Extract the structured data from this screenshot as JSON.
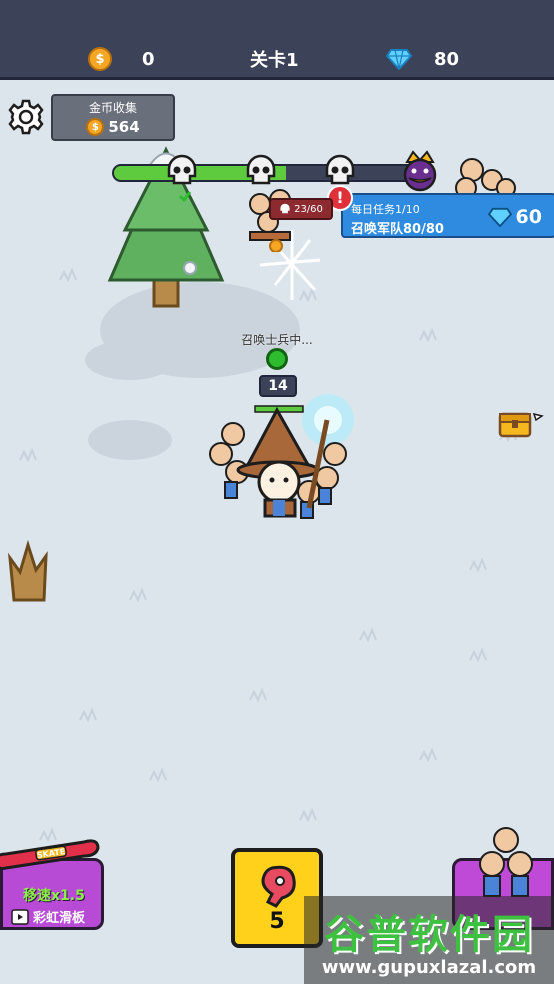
{
  "topbar": {
    "coins": "0",
    "level": "关卡1",
    "gems": "80"
  },
  "coin_collect": {
    "title": "金币收集",
    "value": "564"
  },
  "progress": {
    "fraction": 0.55
  },
  "mission": {
    "line1": "每日任务1/10",
    "line2": "召唤军队80/80",
    "reward": "60"
  },
  "enemy_tag": {
    "text": "23/60"
  },
  "summon": {
    "text": "召唤士兵中...",
    "level": "14"
  },
  "skate": {
    "speed": "移速x1.5",
    "name": "彩虹滑板",
    "board_text": "SKATE"
  },
  "meat": {
    "count": "5"
  },
  "watermark": {
    "title": "谷普软件园",
    "url": "www.gupuxlazal.com"
  },
  "colors": {
    "topbar": "#3c4257",
    "progress": "#5ecb3e",
    "mission": "#2e8be0",
    "meat_card": "#ffd11a",
    "skate_card": "#b84bd6"
  }
}
